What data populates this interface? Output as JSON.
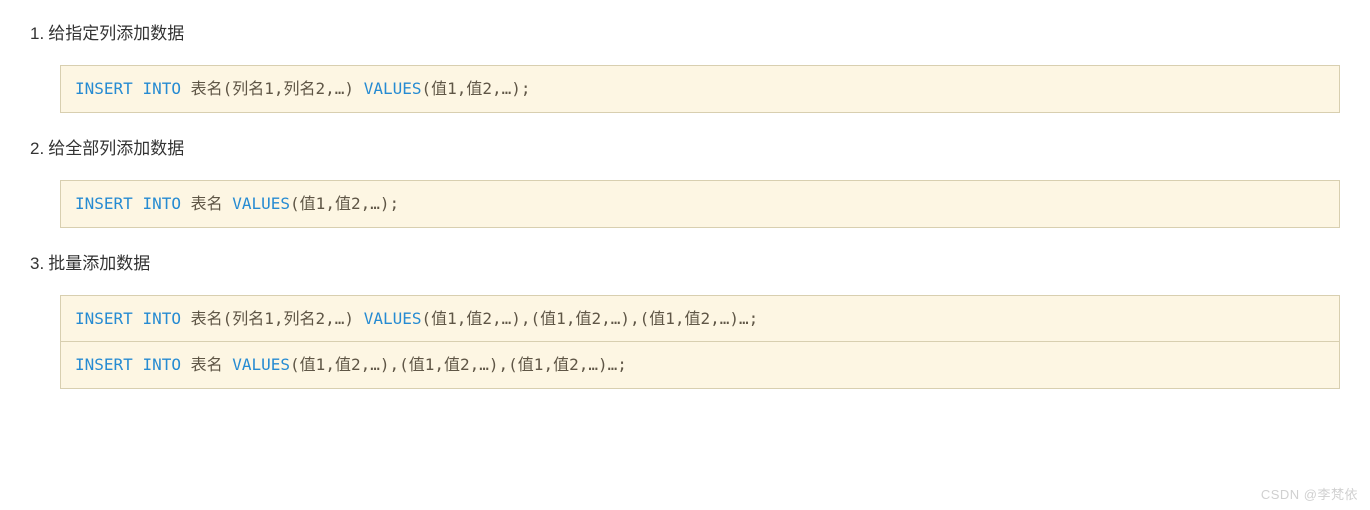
{
  "items": [
    {
      "heading": "给指定列添加数据",
      "code_blocks": [
        [
          {
            "t": "kw",
            "v": "INSERT"
          },
          {
            "t": "sp",
            "v": " "
          },
          {
            "t": "kw",
            "v": "INTO"
          },
          {
            "t": "sp",
            "v": " "
          },
          {
            "t": "txt",
            "v": "表名(列名1,列名2,…) "
          },
          {
            "t": "kw",
            "v": "VALUES"
          },
          {
            "t": "txt",
            "v": "(值1,值2,…);"
          }
        ]
      ]
    },
    {
      "heading": "给全部列添加数据",
      "code_blocks": [
        [
          {
            "t": "kw",
            "v": "INSERT"
          },
          {
            "t": "sp",
            "v": " "
          },
          {
            "t": "kw",
            "v": "INTO"
          },
          {
            "t": "sp",
            "v": " "
          },
          {
            "t": "txt",
            "v": "表名 "
          },
          {
            "t": "kw",
            "v": "VALUES"
          },
          {
            "t": "txt",
            "v": "(值1,值2,…);"
          }
        ]
      ]
    },
    {
      "heading": "批量添加数据",
      "code_blocks": [
        [
          {
            "t": "kw",
            "v": "INSERT"
          },
          {
            "t": "sp",
            "v": " "
          },
          {
            "t": "kw",
            "v": "INTO"
          },
          {
            "t": "sp",
            "v": " "
          },
          {
            "t": "txt",
            "v": "表名(列名1,列名2,…) "
          },
          {
            "t": "kw",
            "v": "VALUES"
          },
          {
            "t": "txt",
            "v": "(值1,值2,…),(值1,值2,…),(值1,值2,…)…;"
          }
        ],
        [
          {
            "t": "kw",
            "v": "INSERT"
          },
          {
            "t": "sp",
            "v": " "
          },
          {
            "t": "kw",
            "v": "INTO"
          },
          {
            "t": "sp",
            "v": " "
          },
          {
            "t": "txt",
            "v": "表名 "
          },
          {
            "t": "kw",
            "v": "VALUES"
          },
          {
            "t": "txt",
            "v": "(值1,值2,…),(值1,值2,…),(值1,值2,…)…;"
          }
        ]
      ]
    }
  ],
  "watermark": "CSDN @李梵依"
}
